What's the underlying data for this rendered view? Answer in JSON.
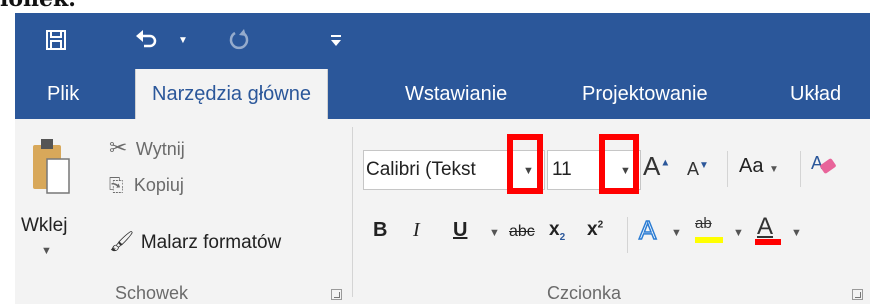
{
  "document": {
    "fragment_text": "lonek."
  },
  "qat": {
    "save_icon": "save-icon",
    "undo_icon": "undo-icon",
    "undo_dropdown_icon": "chevron-down-icon",
    "redo_icon": "redo-icon",
    "customize_icon": "customize-qat-icon"
  },
  "tabs": [
    {
      "label": "Plik"
    },
    {
      "label": "Narzędzia główne"
    },
    {
      "label": "Wstawianie"
    },
    {
      "label": "Projektowanie"
    },
    {
      "label": "Układ"
    }
  ],
  "clipboard": {
    "paste_label": "Wklej",
    "cut_label": "Wytnij",
    "copy_label": "Kopiuj",
    "format_painter_label": "Malarz formatów",
    "group_label": "Schowek"
  },
  "font": {
    "font_name": "Calibri (Tekst",
    "font_size": "11",
    "change_case_label": "Aa",
    "bold_label": "B",
    "italic_label": "I",
    "underline_label": "U",
    "strikethrough_label": "abc",
    "subscript_label": "x",
    "subscript_sub": "2",
    "superscript_label": "x",
    "superscript_sup": "2",
    "text_effects_label": "A",
    "highlight_label": "ab",
    "font_color_label": "A",
    "group_label": "Czcionka"
  },
  "colors": {
    "accent": "#2b579a",
    "ribbon_bg": "#f3f3f3",
    "highlight_bar": "#ffff00",
    "font_color_bar": "#ff0000",
    "annotation": "#ff0000"
  }
}
